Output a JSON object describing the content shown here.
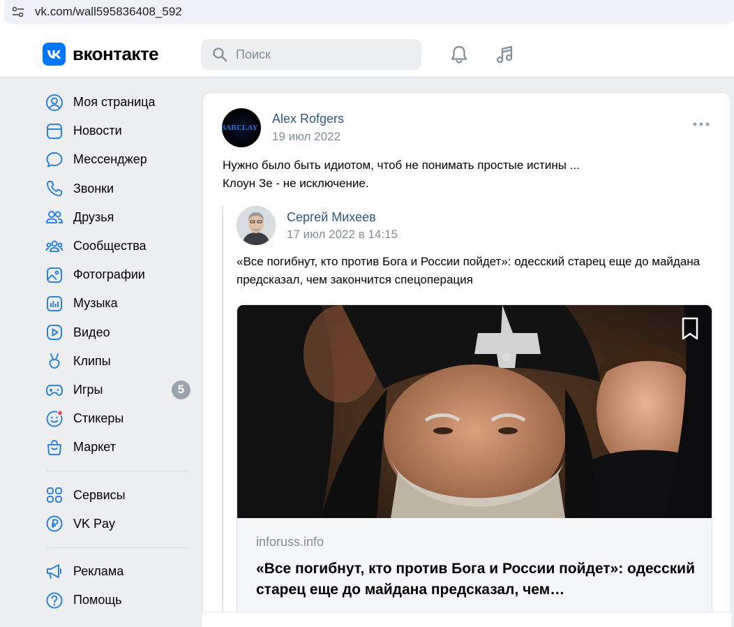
{
  "browser": {
    "url": "vk.com/wall595836408_592"
  },
  "header": {
    "logo_text": "вконтакте",
    "search_placeholder": "Поиск",
    "accent_color": "#0077ff"
  },
  "sidebar": {
    "items": [
      {
        "label": "Моя страница",
        "icon": "profile-icon"
      },
      {
        "label": "Новости",
        "icon": "news-icon"
      },
      {
        "label": "Мессенджер",
        "icon": "messenger-icon"
      },
      {
        "label": "Звонки",
        "icon": "phone-icon"
      },
      {
        "label": "Друзья",
        "icon": "friends-icon"
      },
      {
        "label": "Сообщества",
        "icon": "communities-icon"
      },
      {
        "label": "Фотографии",
        "icon": "photos-icon"
      },
      {
        "label": "Музыка",
        "icon": "music-icon"
      },
      {
        "label": "Видео",
        "icon": "video-icon"
      },
      {
        "label": "Клипы",
        "icon": "clips-icon"
      },
      {
        "label": "Игры",
        "icon": "games-icon",
        "badge": "5"
      },
      {
        "label": "Стикеры",
        "icon": "stickers-icon"
      },
      {
        "label": "Маркет",
        "icon": "market-icon"
      }
    ],
    "items2": [
      {
        "label": "Сервисы",
        "icon": "services-icon"
      },
      {
        "label": "VK Pay",
        "icon": "vkpay-icon"
      }
    ],
    "items3": [
      {
        "label": "Реклама",
        "icon": "ads-icon"
      },
      {
        "label": "Помощь",
        "icon": "help-icon"
      }
    ]
  },
  "post": {
    "author": "Alex Rofgers",
    "avatar_text": "BARCLAY",
    "date": "19 июл 2022",
    "text_line1": "Нужно было быть идиотом, чтоб не понимать простые истины ...",
    "text_line2": "Клоун Зе - не исключение.",
    "repost": {
      "author": "Сергей Михеев",
      "date": "17 июл 2022 в 14:15",
      "text": "«Все погибнут, кто против Бога и России пойдет»: одесский старец еще до майдана предсказал, чем закончится спецоперация",
      "link": {
        "domain": "inforuss.info",
        "title": "«Все погибнут, кто против Бога и России пойдет»: одесский старец еще до майдана предсказал, чем…"
      }
    }
  }
}
